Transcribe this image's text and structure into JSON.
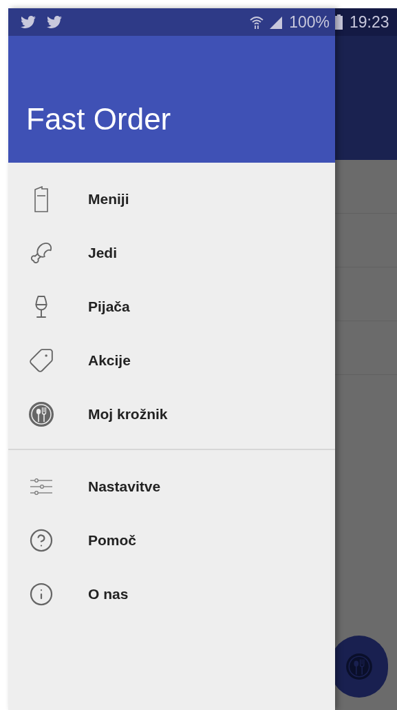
{
  "status_bar": {
    "battery": "100%",
    "time": "19:23"
  },
  "drawer": {
    "title": "Fast Order",
    "main_items": [
      {
        "label": "Meniji"
      },
      {
        "label": "Jedi"
      },
      {
        "label": "Pijača"
      },
      {
        "label": "Akcije"
      },
      {
        "label": "Moj krožnik"
      }
    ],
    "secondary_items": [
      {
        "label": "Nastavitve"
      },
      {
        "label": "Pomoč"
      },
      {
        "label": "O nas"
      }
    ]
  }
}
